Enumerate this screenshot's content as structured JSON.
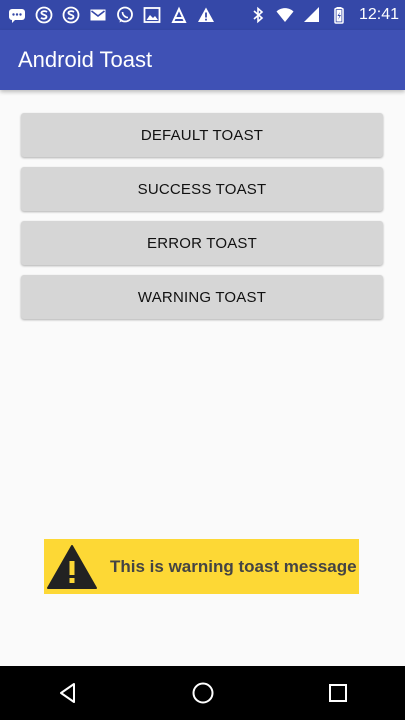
{
  "status_bar": {
    "time": "12:41",
    "left_icons": [
      "chat-icon",
      "skype-icon",
      "skype-icon",
      "mail-icon",
      "whatsapp-icon",
      "gallery-icon",
      "android-icon",
      "warning-icon"
    ],
    "right_icons": [
      "bluetooth-icon",
      "wifi-icon",
      "signal-icon",
      "battery-icon"
    ]
  },
  "app_bar": {
    "title": "Android Toast"
  },
  "buttons": {
    "default": "DEFAULT TOAST",
    "success": "SUCCESS TOAST",
    "error": "ERROR TOAST",
    "warning": "WARNING TOAST"
  },
  "toast": {
    "message": "This is warning toast message",
    "icon": "warning-icon",
    "background": "#fdd835"
  },
  "nav_bar": {
    "icons": [
      "back-icon",
      "home-icon",
      "recents-icon"
    ]
  },
  "colors": {
    "primary": "#3f51b5",
    "primary_dark": "#3548a8"
  }
}
